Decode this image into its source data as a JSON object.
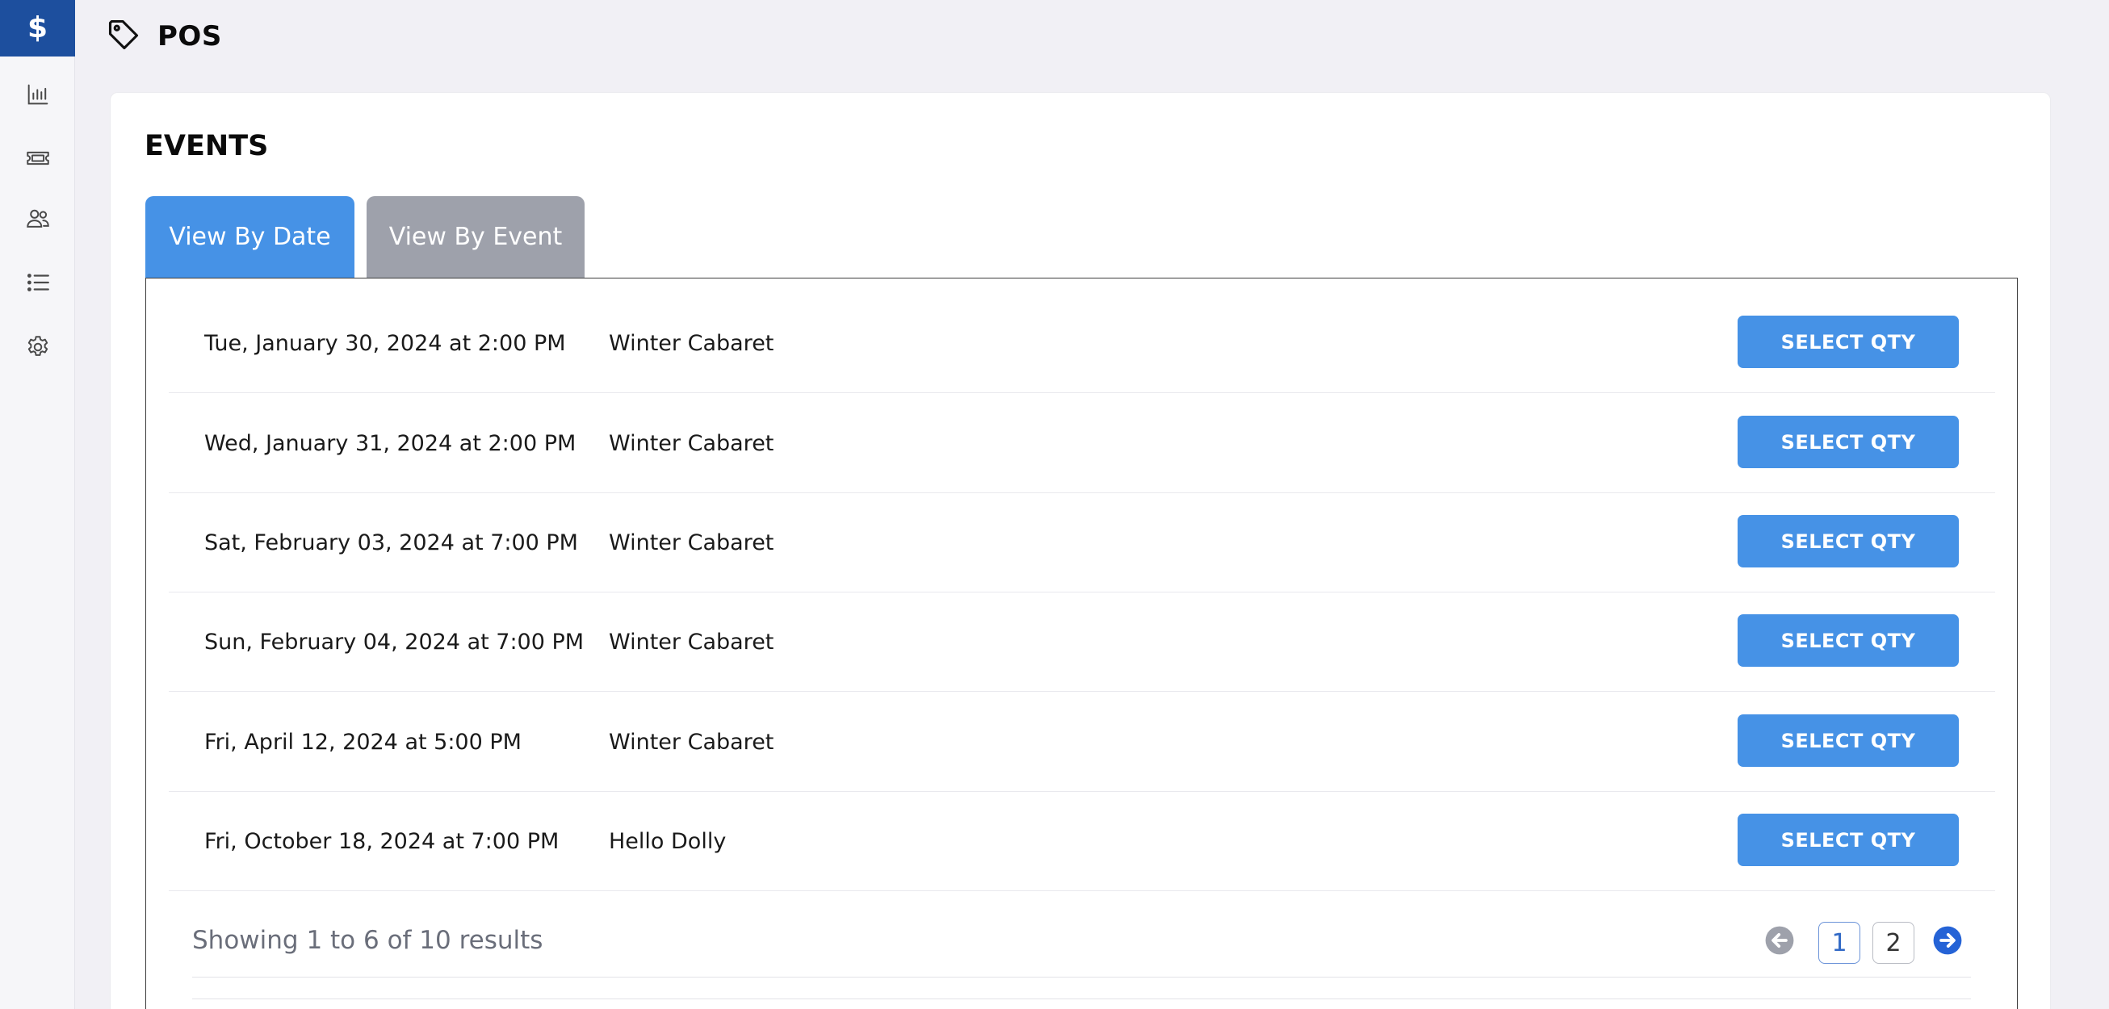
{
  "app": {
    "title": "POS",
    "page_icon": "tag-icon"
  },
  "sidebar": {
    "items": [
      {
        "name": "pos",
        "icon": "dollar-icon",
        "glyph": "$",
        "active": true
      },
      {
        "name": "reports",
        "icon": "bar-chart-icon",
        "active": false
      },
      {
        "name": "tickets",
        "icon": "ticket-icon",
        "active": false
      },
      {
        "name": "customers",
        "icon": "users-icon",
        "active": false
      },
      {
        "name": "lists",
        "icon": "list-icon",
        "active": false
      },
      {
        "name": "settings",
        "icon": "gear-icon",
        "active": false
      }
    ]
  },
  "main": {
    "section_title": "EVENTS",
    "tabs": [
      {
        "label": "View By Date",
        "active": true
      },
      {
        "label": "View By Event",
        "active": false
      }
    ],
    "rows": [
      {
        "date": "Tue, January 30, 2024 at 2:00 PM",
        "event": "Winter Cabaret",
        "action": "SELECT QTY"
      },
      {
        "date": "Wed, January 31, 2024 at 2:00 PM",
        "event": "Winter Cabaret",
        "action": "SELECT QTY"
      },
      {
        "date": "Sat, February 03, 2024 at 7:00 PM",
        "event": "Winter Cabaret",
        "action": "SELECT QTY"
      },
      {
        "date": "Sun, February 04, 2024 at 7:00 PM",
        "event": "Winter Cabaret",
        "action": "SELECT QTY"
      },
      {
        "date": "Fri, April 12, 2024 at 5:00 PM",
        "event": "Winter Cabaret",
        "action": "SELECT QTY"
      },
      {
        "date": "Fri, October 18, 2024 at 7:00 PM",
        "event": "Hello Dolly",
        "action": "SELECT QTY"
      }
    ],
    "pagination": {
      "summary": "Showing 1 to 6 of 10 results",
      "pages": [
        "1",
        "2"
      ],
      "current_page": "1",
      "prev_icon": "arrow-left-circle-icon",
      "next_icon": "arrow-right-circle-icon"
    }
  },
  "colors": {
    "accent": "#4692e6",
    "sidebar_active": "#1d4f9e",
    "inactive_tab": "#9ea1ab",
    "background": "#f1f0f5"
  }
}
